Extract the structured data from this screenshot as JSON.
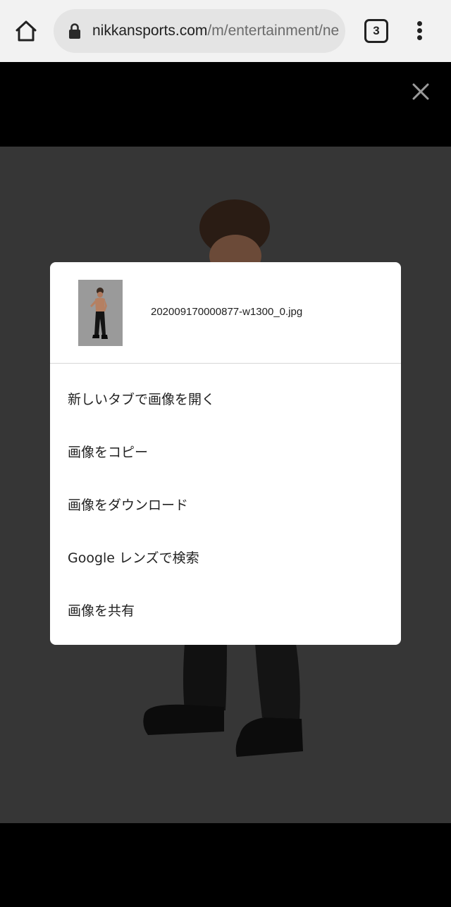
{
  "browser": {
    "url_host": "nikkansports.com",
    "url_path": "/m/entertainment/ne",
    "tab_count": "3",
    "icons": {
      "home": "home-icon",
      "lock": "lock-icon",
      "tabs": "tab-switcher-icon",
      "menu": "more-vert-icon"
    }
  },
  "viewer": {
    "close_icon": "close-icon"
  },
  "dialog": {
    "filename": "202009170000877-w1300_0.jpg",
    "items": [
      {
        "label": "新しいタブで画像を開く"
      },
      {
        "label": "画像をコピー"
      },
      {
        "label": "画像をダウンロード"
      },
      {
        "label": "Google レンズで検索"
      },
      {
        "label": "画像を共有"
      }
    ]
  },
  "colors": {
    "toolbar_bg": "#f2f2f2",
    "omnibox_bg": "#e4e4e4",
    "viewer_bg": "#000000",
    "photo_bg": "#363636",
    "dialog_bg": "#ffffff"
  }
}
